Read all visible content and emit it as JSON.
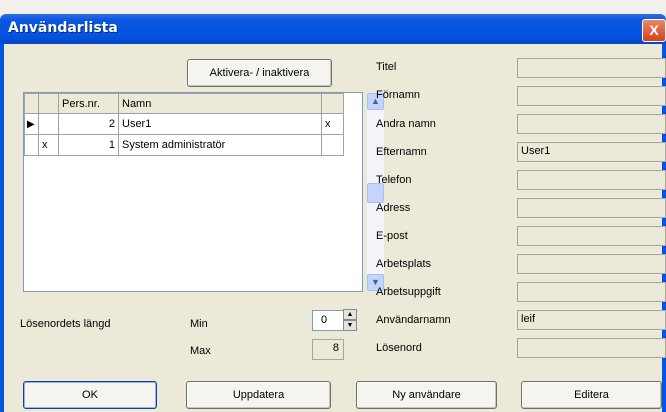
{
  "window": {
    "title": "Användarlista",
    "close_glyph": "X"
  },
  "toolbar": {
    "activate_label": "Aktivera- / inaktivera"
  },
  "grid": {
    "columns": [
      "",
      "",
      "Pers.nr.",
      "Namn",
      ""
    ],
    "rows": [
      {
        "indicator": "▶",
        "mark": "",
        "persnr": "2",
        "name": "User1",
        "flag": "x"
      },
      {
        "indicator": "",
        "mark": "x",
        "persnr": "1",
        "name": "System administratör",
        "flag": ""
      }
    ]
  },
  "password": {
    "length_label": "Lösenordets längd",
    "min_label": "Min",
    "min_value": "0",
    "max_label": "Max",
    "max_value": "8"
  },
  "fields": [
    {
      "label": "Titel",
      "value": ""
    },
    {
      "label": "Förnamn",
      "value": ""
    },
    {
      "label": "Andra namn",
      "value": ""
    },
    {
      "label": "Efternamn",
      "value": "User1"
    },
    {
      "label": "Telefon",
      "value": ""
    },
    {
      "label": "Adress",
      "value": ""
    },
    {
      "label": "E-post",
      "value": ""
    },
    {
      "label": "Arbetsplats",
      "value": ""
    },
    {
      "label": "Arbetsuppgift",
      "value": ""
    },
    {
      "label": "Användarnamn",
      "value": "leif"
    },
    {
      "label": "Lösenord",
      "value": ""
    }
  ],
  "buttons": {
    "ok": "OK",
    "update": "Uppdatera",
    "new_user": "Ny användare",
    "edit": "Editera"
  }
}
